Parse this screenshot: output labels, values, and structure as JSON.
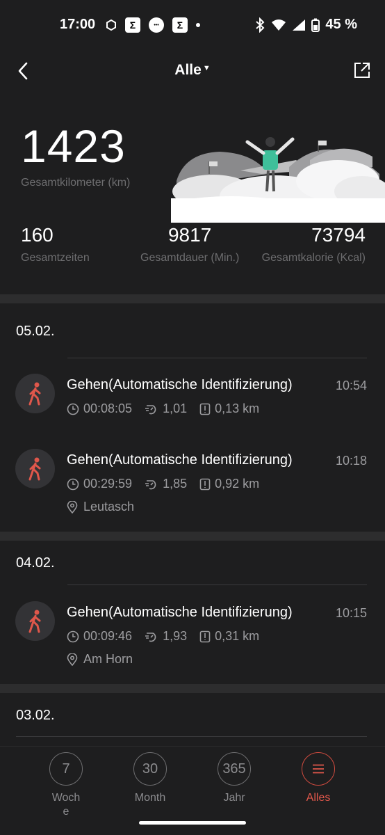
{
  "status_bar": {
    "time": "17:00",
    "battery": "45 %"
  },
  "nav": {
    "title": "Alle"
  },
  "summary": {
    "total_km": "1423",
    "total_km_label": "Gesamtkilometer (km)",
    "count": "160",
    "count_label": "Gesamtzeiten",
    "duration": "9817",
    "duration_label": "Gesamtdauer (Min.)",
    "calories": "73794",
    "calories_label": "Gesamtkalorie (Kcal)"
  },
  "groups": [
    {
      "date": "05.02.",
      "items": [
        {
          "name": "Gehen(Automatische Identifizierung)",
          "time": "10:54",
          "duration": "00:08:05",
          "pace": "1,01",
          "distance": "0,13 km",
          "location": ""
        },
        {
          "name": "Gehen(Automatische Identifizierung)",
          "time": "10:18",
          "duration": "00:29:59",
          "pace": "1,85",
          "distance": "0,92 km",
          "location": "Leutasch"
        }
      ]
    },
    {
      "date": "04.02.",
      "items": [
        {
          "name": "Gehen(Automatische Identifizierung)",
          "time": "10:15",
          "duration": "00:09:46",
          "pace": "1,93",
          "distance": "0,31 km",
          "location": "Am Horn"
        }
      ]
    },
    {
      "date": "03.02.",
      "items": []
    }
  ],
  "tabs": [
    {
      "icon_text": "7",
      "label_line1": "Woch",
      "label_line2": "e"
    },
    {
      "icon_text": "30",
      "label_line1": "Month"
    },
    {
      "icon_text": "365",
      "label_line1": "Jahr"
    },
    {
      "icon": "menu-icon",
      "label_line1": "Alles"
    }
  ],
  "colors": {
    "accent": "#e0574b",
    "background": "#1e1e1f",
    "muted": "#6d6d6f"
  }
}
